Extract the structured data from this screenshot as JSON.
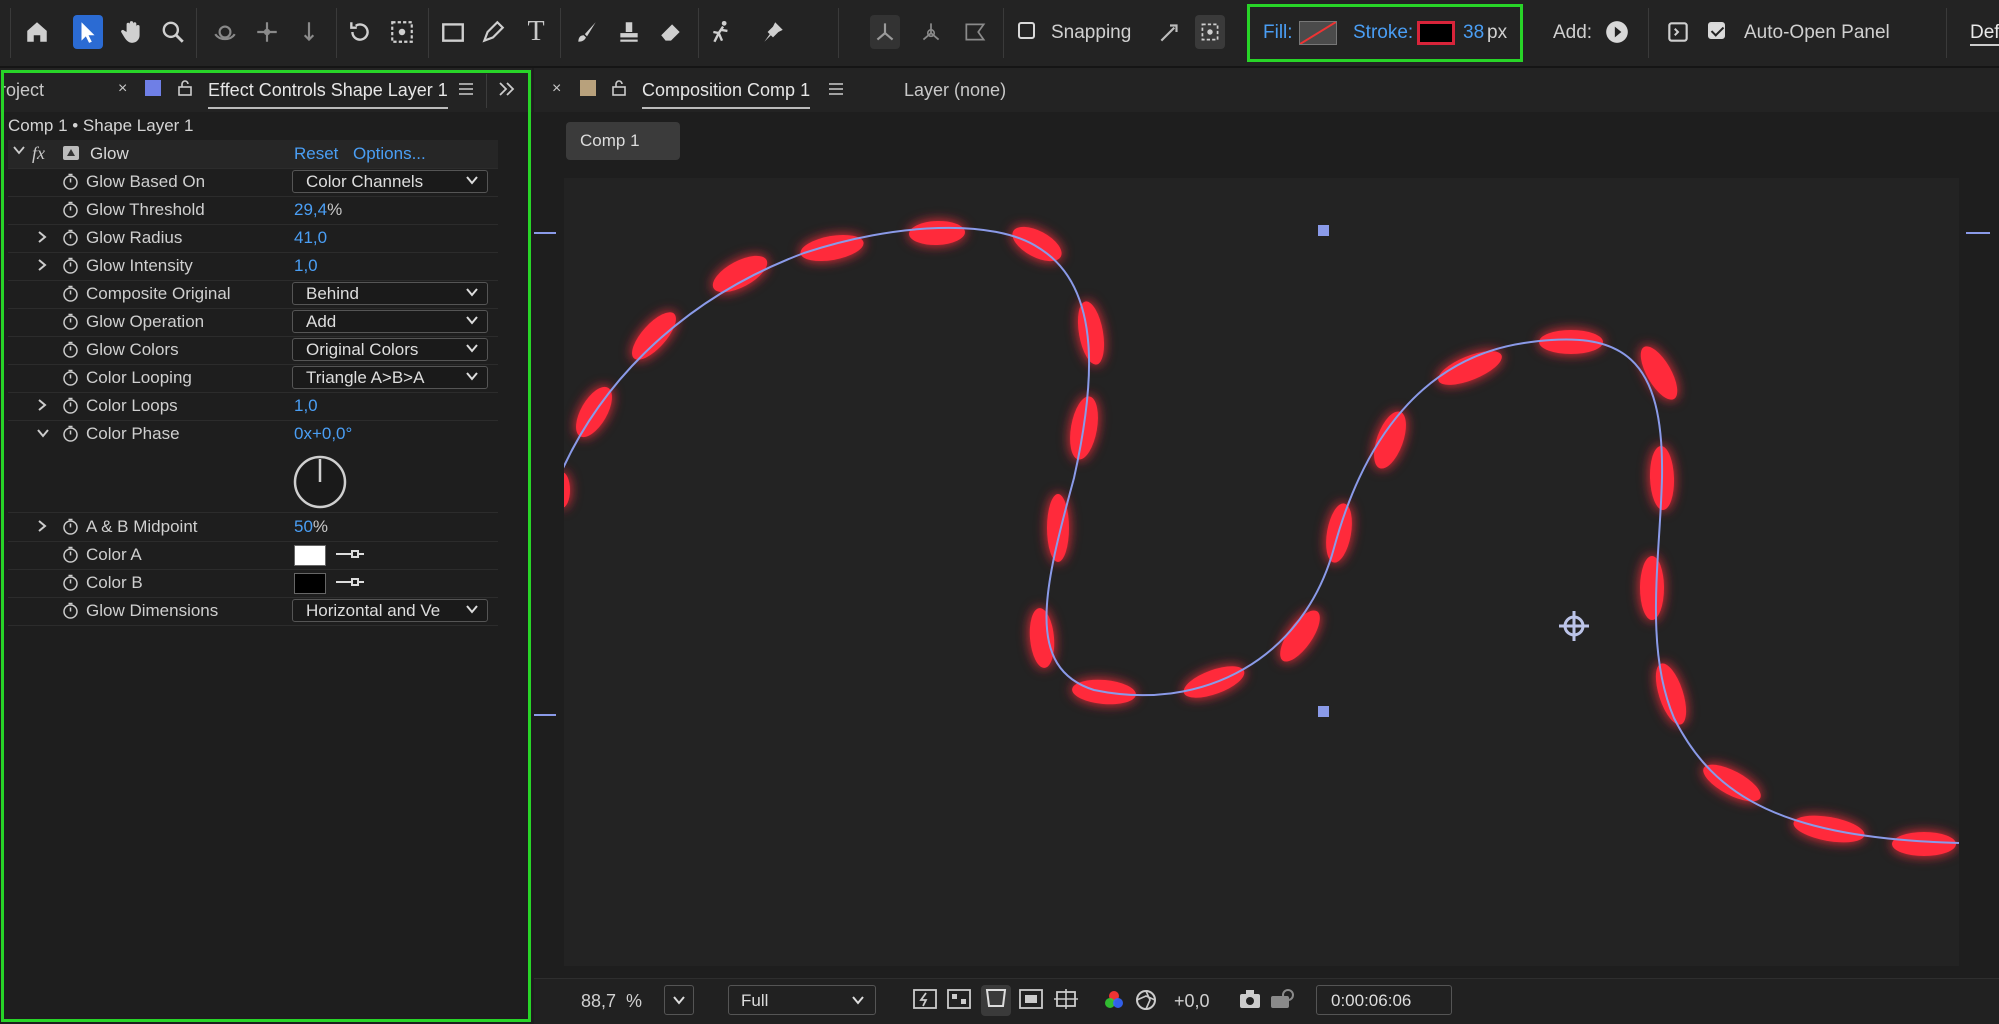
{
  "toolbar": {
    "tools": [
      "home-icon",
      "selection-arrow-icon",
      "hand-icon",
      "zoom-icon",
      "orbit-camera-icon",
      "pan-camera-icon",
      "dolly-camera-icon",
      "rotate-icon",
      "anchor-point-icon",
      "rectangle-icon",
      "pen-icon",
      "type-icon",
      "brush-icon",
      "clone-stamp-icon",
      "eraser-icon",
      "puppet-icon",
      "pin-icon"
    ],
    "snapping_label": "Snapping",
    "fill_label": "Fill:",
    "stroke_label": "Stroke:",
    "stroke_width": "38",
    "stroke_unit": "px",
    "add_label": "Add:",
    "auto_open_label": "Auto-Open Panel",
    "workspace_label": "Def",
    "stroke_color": "#000000",
    "highlight_color": "#28d428"
  },
  "left_panel": {
    "project_tab": "roject",
    "effect_tab": "Effect Controls Shape Layer 1",
    "header": "Comp 1 • Shape Layer 1",
    "effect": {
      "fx": "fx",
      "name": "Glow",
      "reset": "Reset",
      "options": "Options..."
    },
    "properties": [
      {
        "label": "Glow Based On",
        "dropdown": "Color Channels"
      },
      {
        "label": "Glow Threshold",
        "value": "29,4",
        "unit": "%"
      },
      {
        "label": "Glow Radius",
        "value": "41,0"
      },
      {
        "label": "Glow Intensity",
        "value": "1,0"
      },
      {
        "label": "Composite Original",
        "dropdown": "Behind"
      },
      {
        "label": "Glow Operation",
        "dropdown": "Add"
      },
      {
        "label": "Glow Colors",
        "dropdown": "Original Colors"
      },
      {
        "label": "Color Looping",
        "dropdown": "Triangle A>B>A"
      },
      {
        "label": "Color Loops",
        "value": "1,0"
      },
      {
        "label": "Color Phase",
        "value": "0x+0,0°"
      },
      {
        "label": "A & B Midpoint",
        "value": "50",
        "unit": "%"
      },
      {
        "label": "Color A",
        "color": "#ffffff"
      },
      {
        "label": "Color B",
        "color": "#000000"
      },
      {
        "label": "Glow Dimensions",
        "dropdown": "Horizontal and Ve"
      }
    ]
  },
  "composition": {
    "tab": "Composition Comp 1",
    "layer_tab": "Layer (none)",
    "breadcrumb": "Comp 1",
    "glow_color": "#ff2a3a",
    "path_color": "#8a9ae8"
  },
  "viewer_bar": {
    "zoom": "88,7",
    "zoom_unit": "%",
    "resolution": "Full",
    "exposure": "+0,0",
    "timecode": "0:00:06:06"
  }
}
